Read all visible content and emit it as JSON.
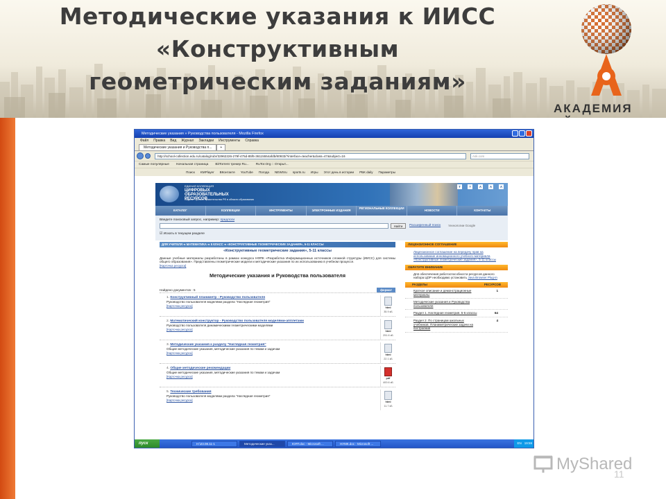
{
  "slide": {
    "title_line1": "Методические указания к ИИСС",
    "title_line2": "«Конструктивным",
    "title_line3": "геометрическим заданиям»",
    "brand": "АКАДЕМИЯ АЙТИ",
    "page_number": "11",
    "watermark": "MyShared",
    "colors": {
      "accent": "#e8641b",
      "title": "#3d3d3d"
    }
  },
  "browser": {
    "window_title": "Методические указания » Руководства пользователя - Mozilla Firefox",
    "menu": [
      "Файл",
      "Правка",
      "Вид",
      "Журнал",
      "Закладки",
      "Инструменты",
      "Справка"
    ],
    "tab_label": "Методические указания и Руководства п...",
    "url": "http://school-collection.edu.ru/catalog/rubr/32962226-279f-475d-85f6-36115554afdb/80933/?interface=teacher&class=47&subject=16",
    "search_placeholder": "Ask.com",
    "bookmarks": [
      "Самые популярные",
      "Начальная страница",
      "BitTorrent трекер Ru...",
      "RuTor.Org :: Открыт..."
    ],
    "toolbar2": [
      "Поиск",
      "KMPlayer",
      "ВКонтакте",
      "YouTube",
      "Погода",
      "NEWSru",
      "sports.ru",
      "Игры",
      "Этот день в истории",
      "РБК daily",
      "Параметры"
    ]
  },
  "site": {
    "header_small": "ЕДИНАЯ КОЛЛЕКЦИЯ",
    "header_big": "ЦИФРОВЫХ ОБРАЗОВАТЕЛЬНЫХ РЕСУРСОВ",
    "header_caption": "Лауреат Премии Правительства РФ в области образования",
    "header_icons": [
      "Т",
      "?",
      "A",
      "A",
      "A"
    ],
    "nav": [
      "КАТАЛОГ",
      "КОЛЛЕКЦИИ",
      "ИНСТРУМЕНТЫ",
      "ЭЛЕКТРОННЫЕ ИЗДАНИЯ",
      "РЕГИОНАЛЬНЫЕ КОЛЛЕКЦИИ",
      "НОВОСТИ",
      "КОНТАКТЫ"
    ],
    "search_prompt": "Введите поисковый запрос, например:",
    "search_example": "предлоги",
    "search_button": "Найти",
    "advanced_search": "Расширенный поиск",
    "google": "технологии Google",
    "search_checkbox": "Искать в текущем разделе",
    "breadcrumb": "ДЛЯ УЧИТЕЛЯ  ➜  МАТЕМАТИКА  ➜  5 КЛАСС  ➜  «КОНСТРУКТИВНЫЕ ГЕОМЕТРИЧЕСКИЕ ЗАДАНИЯ», 5-11 КЛАССЫ",
    "section_title": "«Конструктивные геометрические задания», 5-11 классы",
    "description": "Данные учебные материалы разработаны в рамках конкурса НФПК «Разработка Информационных источников сложной структуры (ИИСС) для системы общего образования». Представлены геометрические модели и методические указания по их использованию в учебном процессе.",
    "card_link": "[Карточка ресурса]",
    "page_heading": "Методические указания и Руководства пользователя",
    "found": "Найдено документов - 5",
    "format_label": "формат",
    "documents": [
      {
        "n": "1.",
        "title": "Конструктивный планиметр - Руководство пользователя",
        "desc": "Руководство пользователя моделями раздела \"Наглядная геометрия\"",
        "fmt": "html",
        "size": "35.9 кБ"
      },
      {
        "n": "2.",
        "title": "Математический конструктор - Руководство пользователя моделями-апплетами",
        "desc": "Руководство пользователя динамическими геометрическими моделями",
        "fmt": "html",
        "size": "251.6 кБ"
      },
      {
        "n": "3.",
        "title": "Методические указания к разделу \"Наглядная геометрия\"",
        "desc": "Общие методические указания, методические указания по темам и задачам",
        "fmt": "html",
        "size": "22.1 кБ"
      },
      {
        "n": "4.",
        "title": "Общие методические рекомендации",
        "desc": "Общие методические указания, методические указания по темам и задачам",
        "fmt": "pdf",
        "size": "400.6 кБ"
      },
      {
        "n": "5.",
        "title": "Технические требования",
        "desc": "Руководство пользователя моделями раздела \"Наглядная геометрия\"",
        "fmt": "html",
        "size": "11.7 кБ"
      }
    ],
    "sidebar": {
      "license_head": "ЛИЦЕНЗИОННОЕ СОГЛАШЕНИЕ",
      "license_text": "Лицензионное соглашение на передачу прав на использование инновационного учебного материала «Конструктивные геометрические задания», 5-11 классы",
      "attention_head": "ОБРАТИТЕ ВНИМАНИЕ",
      "attention_text": "Для обеспечения работоспособности ресурсов данного набора ЦОР необходимо установить",
      "attention_link": "Java Browser Plug-in",
      "table_head_left": "РАЗДЕЛЫ",
      "table_head_right": "РЕСУРСОВ",
      "rows": [
        {
          "name": "Краткое описание и демонстрационные материалы",
          "count": "1"
        },
        {
          "name": "Методические указания и Руководства пользователя",
          "count": ""
        },
        {
          "name": "Раздел 1. Наглядная геометрия. 5-6 классы",
          "count": "64"
        },
        {
          "name": "Раздел 2. По страницам школьных учебников. Планиметрические задачи на построение",
          "count": "4"
        }
      ]
    }
  },
  "taskbar": {
    "start": "пуск",
    "tasks": [
      "H:\\23.08.11-1",
      "Методические указ...",
      "ЮЯТ.doc - Microsoft ...",
      "НУМК.doc - Microsoft ..."
    ],
    "lang": "EN",
    "clock": "19:59"
  }
}
